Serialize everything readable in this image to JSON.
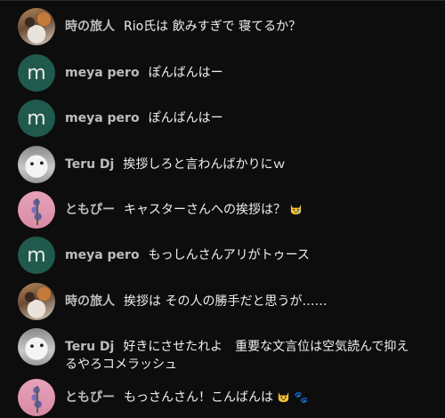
{
  "messages": [
    {
      "author": "時の旅人",
      "text": "Rio氏は 飲みすぎで 寝てるか？",
      "avatar": "calico-cat"
    },
    {
      "author": "meya pero",
      "text": "ぽんばんはー",
      "avatar": "letter",
      "letter": "m"
    },
    {
      "author": "meya pero",
      "text": "ぽんばんはー",
      "avatar": "letter",
      "letter": "m"
    },
    {
      "author": "Teru Dj",
      "text": "挨拶しろと言わんばかりにｗ",
      "avatar": "white-cat"
    },
    {
      "author": "ともぴー",
      "text": "キャスターさんへの挨拶は？",
      "avatar": "lavender-flower",
      "emoji": "crying-cat-face"
    },
    {
      "author": "meya pero",
      "text": "もっしんさんアリがトゥース",
      "avatar": "letter",
      "letter": "m"
    },
    {
      "author": "時の旅人",
      "text": "挨拶は その人の勝手だと思うが……",
      "avatar": "calico-cat"
    },
    {
      "author": "Teru Dj",
      "text": "好きにさせたれよ　重要な文言位は空気読んで抑え",
      "text_line2": "るやろコメラッシュ",
      "avatar": "white-cat"
    },
    {
      "author": "ともぴー",
      "text": "もっさんさん！こんばんは",
      "avatar": "lavender-flower",
      "emoji": "grinning-cat-face",
      "emoji2": "paw-prints"
    }
  ],
  "colors": {
    "background": "#0d0d0d",
    "letter_avatar": "#1f5a4c",
    "author": "#bdbdbd",
    "text": "#f0f0f0"
  }
}
